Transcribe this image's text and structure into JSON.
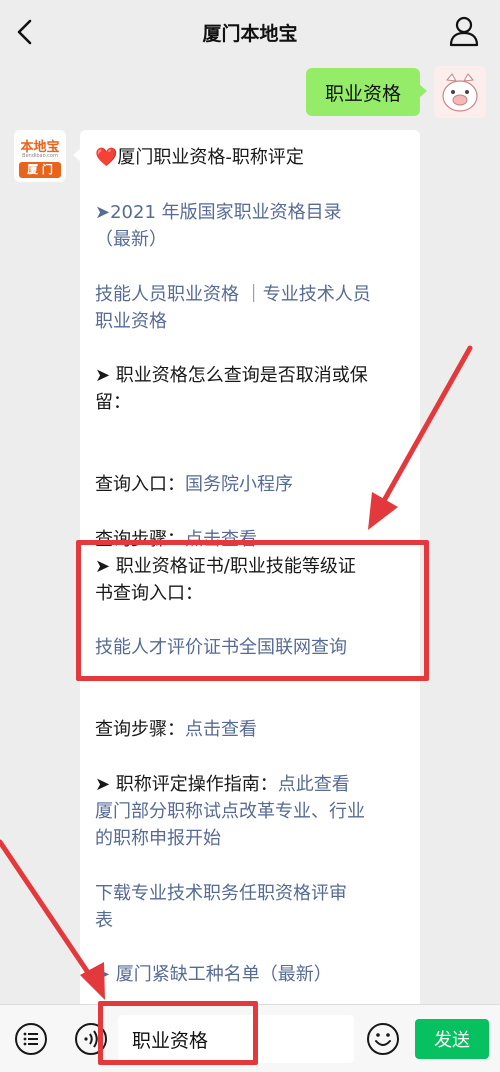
{
  "header": {
    "title": "厦门本地宝"
  },
  "my_message": {
    "text": "职业资格"
  },
  "bot": {
    "logo_top": "本地宝",
    "logo_url": "Bendibao.com",
    "logo_city": "厦 门"
  },
  "message": {
    "heading": "❤️厦门职业资格-职称评定",
    "catalog": "➤2021 年版国家职业资格目录\n（最新）",
    "skill_professional": "技能人员职业资格 ｜专业技术人员\n职业资格",
    "query_cancel": "➤ 职业资格怎么查询是否取消或保\n留：",
    "entry_label": "查询入口：",
    "entry_link": "国务院小程序",
    "steps_label": "查询步骤：",
    "steps_link": "点击查看",
    "cert_query": "➤ 职业资格证书/职业技能等级证\n书查询入口：",
    "cert_link": "技能人才评价证书全国联网查询",
    "steps2_label": "查询步骤：",
    "steps2_link": "点击查看",
    "title_guide_label": "➤ 职称评定操作指南：",
    "title_guide_link": "点此查看",
    "reform": "厦门部分职称试点改革专业、行业\n的职称申报开始",
    "download": "下载专业技术职务任职资格评审\n表",
    "shortage": "➤ 厦门紧缺工种名单（最新）"
  },
  "input_bar": {
    "value": "职业资格",
    "send_label": "发送"
  },
  "colors": {
    "accent_green": "#07c160",
    "bubble_green": "#95ec69",
    "link": "#576b95",
    "annotation_red": "#e4393c"
  }
}
